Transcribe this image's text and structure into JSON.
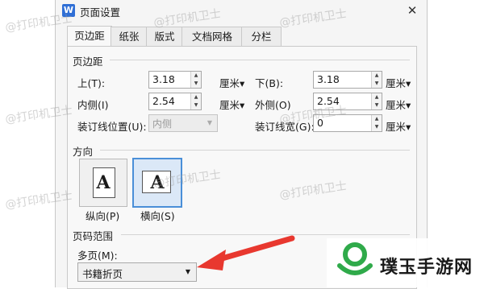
{
  "window": {
    "title": "页面设置",
    "app_badge": "W",
    "close_glyph": "✕"
  },
  "tabs": [
    {
      "label": "页边距",
      "active": true
    },
    {
      "label": "纸张",
      "active": false
    },
    {
      "label": "版式",
      "active": false
    },
    {
      "label": "文档网格",
      "active": false
    },
    {
      "label": "分栏",
      "active": false
    }
  ],
  "margins": {
    "section_title": "页边距",
    "top": {
      "label": "上(T):",
      "value": "3.18",
      "unit": "厘米▾"
    },
    "bottom": {
      "label": "下(B):",
      "value": "3.18",
      "unit": "厘米▾"
    },
    "inside": {
      "label": "内侧(I)",
      "value": "2.54",
      "unit": "厘米▾"
    },
    "outside": {
      "label": "外侧(O)",
      "value": "2.54",
      "unit": "厘米▾"
    },
    "gutter_position": {
      "label": "装订线位置(U):",
      "value": "内侧"
    },
    "gutter_width": {
      "label": "装订线宽(G):",
      "value": "0",
      "unit": "厘米▾"
    }
  },
  "orientation": {
    "section_title": "方向",
    "portrait": {
      "label": "纵向(P)",
      "glyph": "A"
    },
    "landscape": {
      "label": "横向(S)",
      "glyph": "A",
      "selected": true
    }
  },
  "pages": {
    "section_title": "页码范围",
    "multiple_label": "多页(M):",
    "multiple_value": "书籍折页"
  },
  "watermark_text": "@打印机卫士",
  "brand": {
    "name": "璞玉手游网",
    "accent": "#2faa4a"
  },
  "icons": {
    "spin_up": "▲",
    "spin_down": "▼",
    "dropdown": "▼"
  }
}
